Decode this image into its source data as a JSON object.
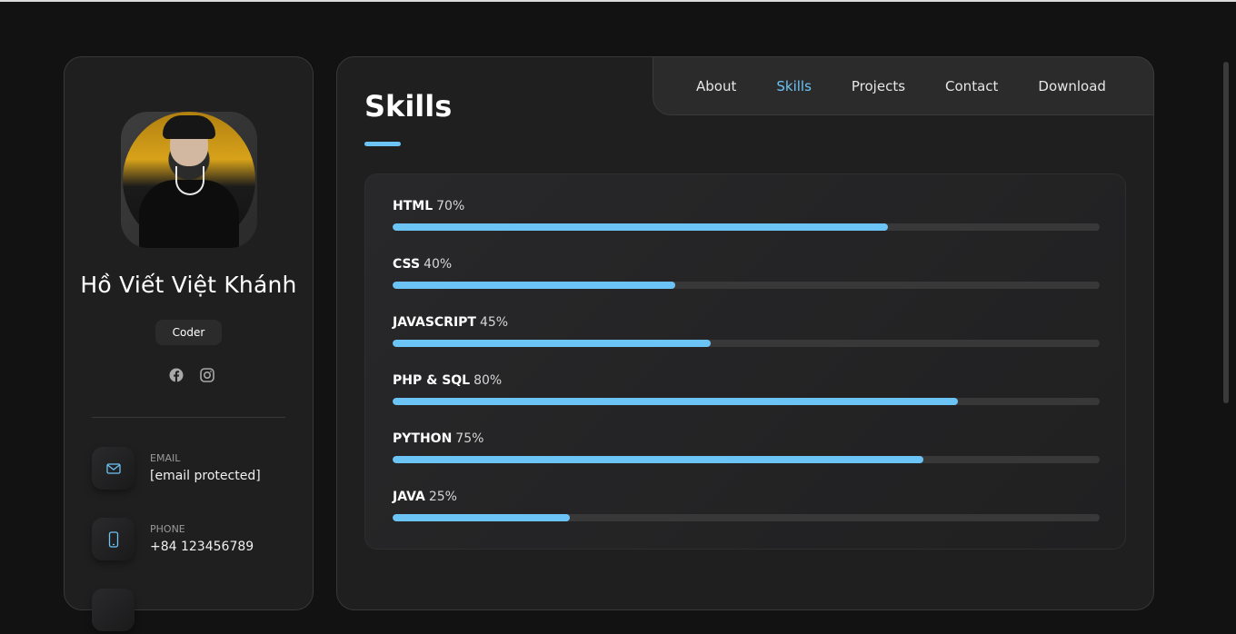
{
  "profile": {
    "name": "Hồ Viết Việt Khánh",
    "role": "Coder",
    "socials": [
      "facebook-icon",
      "instagram-icon"
    ],
    "contacts": [
      {
        "label": "EMAIL",
        "value": "[email protected]",
        "icon": "mail-icon"
      },
      {
        "label": "PHONE",
        "value": "+84 123456789",
        "icon": "phone-icon"
      }
    ]
  },
  "nav": {
    "items": [
      "About",
      "Skills",
      "Projects",
      "Contact",
      "Download"
    ],
    "active": "Skills"
  },
  "page": {
    "title": "Skills"
  },
  "skills": [
    {
      "name": "HTML",
      "percent_label": "70%",
      "value": 70
    },
    {
      "name": "CSS",
      "percent_label": "40%",
      "value": 40
    },
    {
      "name": "JAVASCRIPT",
      "percent_label": "45%",
      "value": 45
    },
    {
      "name": "PHP & SQL",
      "percent_label": "80%",
      "value": 80
    },
    {
      "name": "PYTHON",
      "percent_label": "75%",
      "value": 75
    },
    {
      "name": "JAVA",
      "percent_label": "25%",
      "value": 25
    }
  ],
  "colors": {
    "accent": "#6cc3f6",
    "background": "#121212",
    "card": "#1f1f20"
  }
}
